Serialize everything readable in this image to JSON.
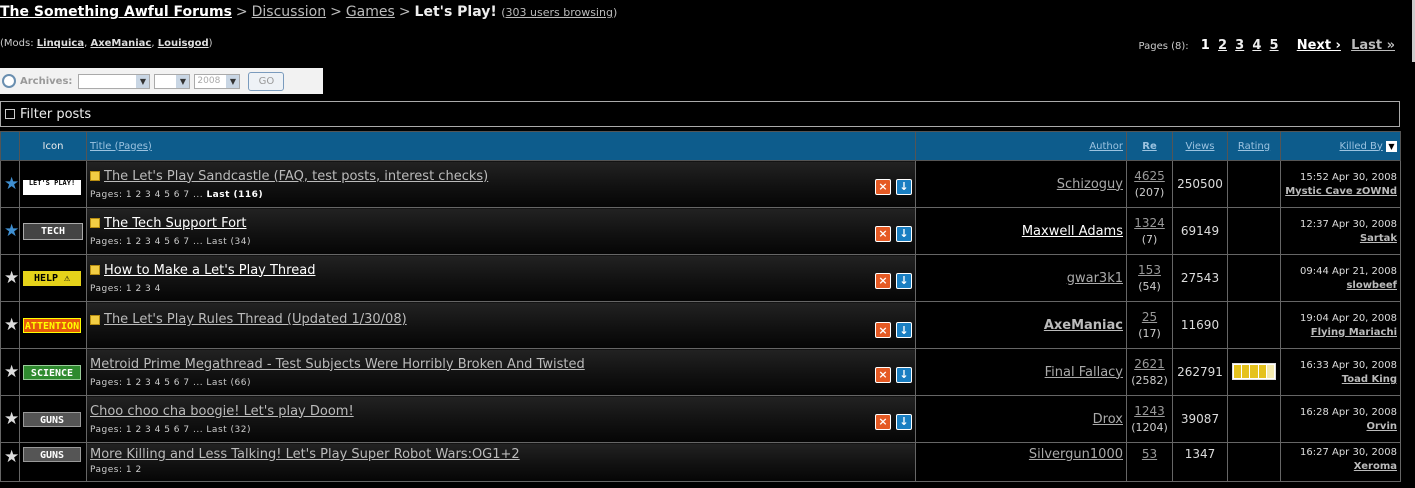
{
  "breadcrumb": {
    "home": "The Something Awful Forums",
    "sep": ">",
    "discussion": "Discussion",
    "games": "Games",
    "current": "Let's Play!",
    "users_open": "(",
    "users_text": "303 users browsing",
    "users_close": ")"
  },
  "mods": {
    "prefix": "(Mods: ",
    "names": [
      "Linquica",
      "AxeManiac",
      "Louisgod"
    ],
    "comma": ",",
    "suffix": ")"
  },
  "pagination": {
    "label": "Pages (8):",
    "pages": [
      "1",
      "2",
      "3",
      "4",
      "5"
    ],
    "next": "Next ›",
    "last": "Last »"
  },
  "archives": {
    "label": "Archives:",
    "month": "",
    "day": "",
    "year": "2008",
    "go": "GO"
  },
  "filter": {
    "label": "Filter posts"
  },
  "table": {
    "headers": {
      "icon": "Icon",
      "title": "Title (Pages)",
      "author": "Author",
      "replies": "Re",
      "views": "Views",
      "rating": "Rating",
      "killed_by": "Killed By"
    },
    "rows": [
      {
        "tag": "LET'S PLAY!",
        "title": "The Let's Play Sandcastle (FAQ, test posts, interest checks)",
        "pages": "Pages: 1 2 3 4 5 6 7 ...",
        "last": "Last (116)",
        "author": "Schizoguy",
        "replies": "4625",
        "unread": "(207)",
        "views": "250500",
        "killed_time": "15:52 Apr 30, 2008",
        "killed_name": "Mystic Cave zOWNd"
      },
      {
        "tag": "TECH",
        "title": "The Tech Support Fort",
        "pages": "Pages: 1 2 3 4 5 6 7 ... Last (34)",
        "last": "",
        "author": "Maxwell Adams",
        "replies": "1324",
        "unread": "(7)",
        "views": "69149",
        "killed_time": "12:37 Apr 30, 2008",
        "killed_name": "Sartak"
      },
      {
        "tag": "HELP ⚠",
        "title": "How to Make a Let's Play Thread",
        "pages": "Pages: 1 2 3 4",
        "last": "",
        "author": "gwar3k1",
        "replies": "153",
        "unread": "(54)",
        "views": "27543",
        "killed_time": "09:44 Apr 21, 2008",
        "killed_name": "slowbeef"
      },
      {
        "tag": "ATTENTION",
        "title": "The Let's Play Rules Thread (Updated 1/30/08)",
        "pages": "",
        "last": "",
        "author": "AxeManiac",
        "replies": "25",
        "unread": "(17)",
        "views": "11690",
        "killed_time": "19:04 Apr 20, 2008",
        "killed_name": "Flying Mariachi"
      },
      {
        "tag": "SCIENCE",
        "title": "Metroid Prime Megathread - Test Subjects Were Horribly Broken And Twisted",
        "pages": "Pages: 1 2 3 4 5 6 7 ... Last (66)",
        "last": "",
        "author": "Final Fallacy",
        "replies": "2621",
        "unread": "(2582)",
        "views": "262791",
        "killed_time": "16:33 Apr 30, 2008",
        "killed_name": "Toad King",
        "rating_stars": 4
      },
      {
        "tag": "GUNS",
        "title": "Choo choo cha boogie! Let's play Doom!",
        "pages": "Pages: 1 2 3 4 5 6 7 ... Last (32)",
        "last": "",
        "author": "Drox",
        "replies": "1243",
        "unread": "(1204)",
        "views": "39087",
        "killed_time": "16:28 Apr 30, 2008",
        "killed_name": "Orvin"
      },
      {
        "tag": "GUNS",
        "title": "More Killing and Less Talking! Let's Play Super Robot Wars:OG1+2",
        "pages": "Pages: 1 2",
        "last": "",
        "author": "Silvergun1000",
        "replies": "53",
        "unread": "",
        "views": "1347",
        "killed_time": "16:27 Apr 30, 2008",
        "killed_name": "Xeroma"
      }
    ]
  },
  "colors": {
    "header_bg": "#0d5c8c",
    "bookmark_blue": "#3f8fd1",
    "rating_gold": "#e5c21c",
    "close_orange": "#e55a24"
  }
}
